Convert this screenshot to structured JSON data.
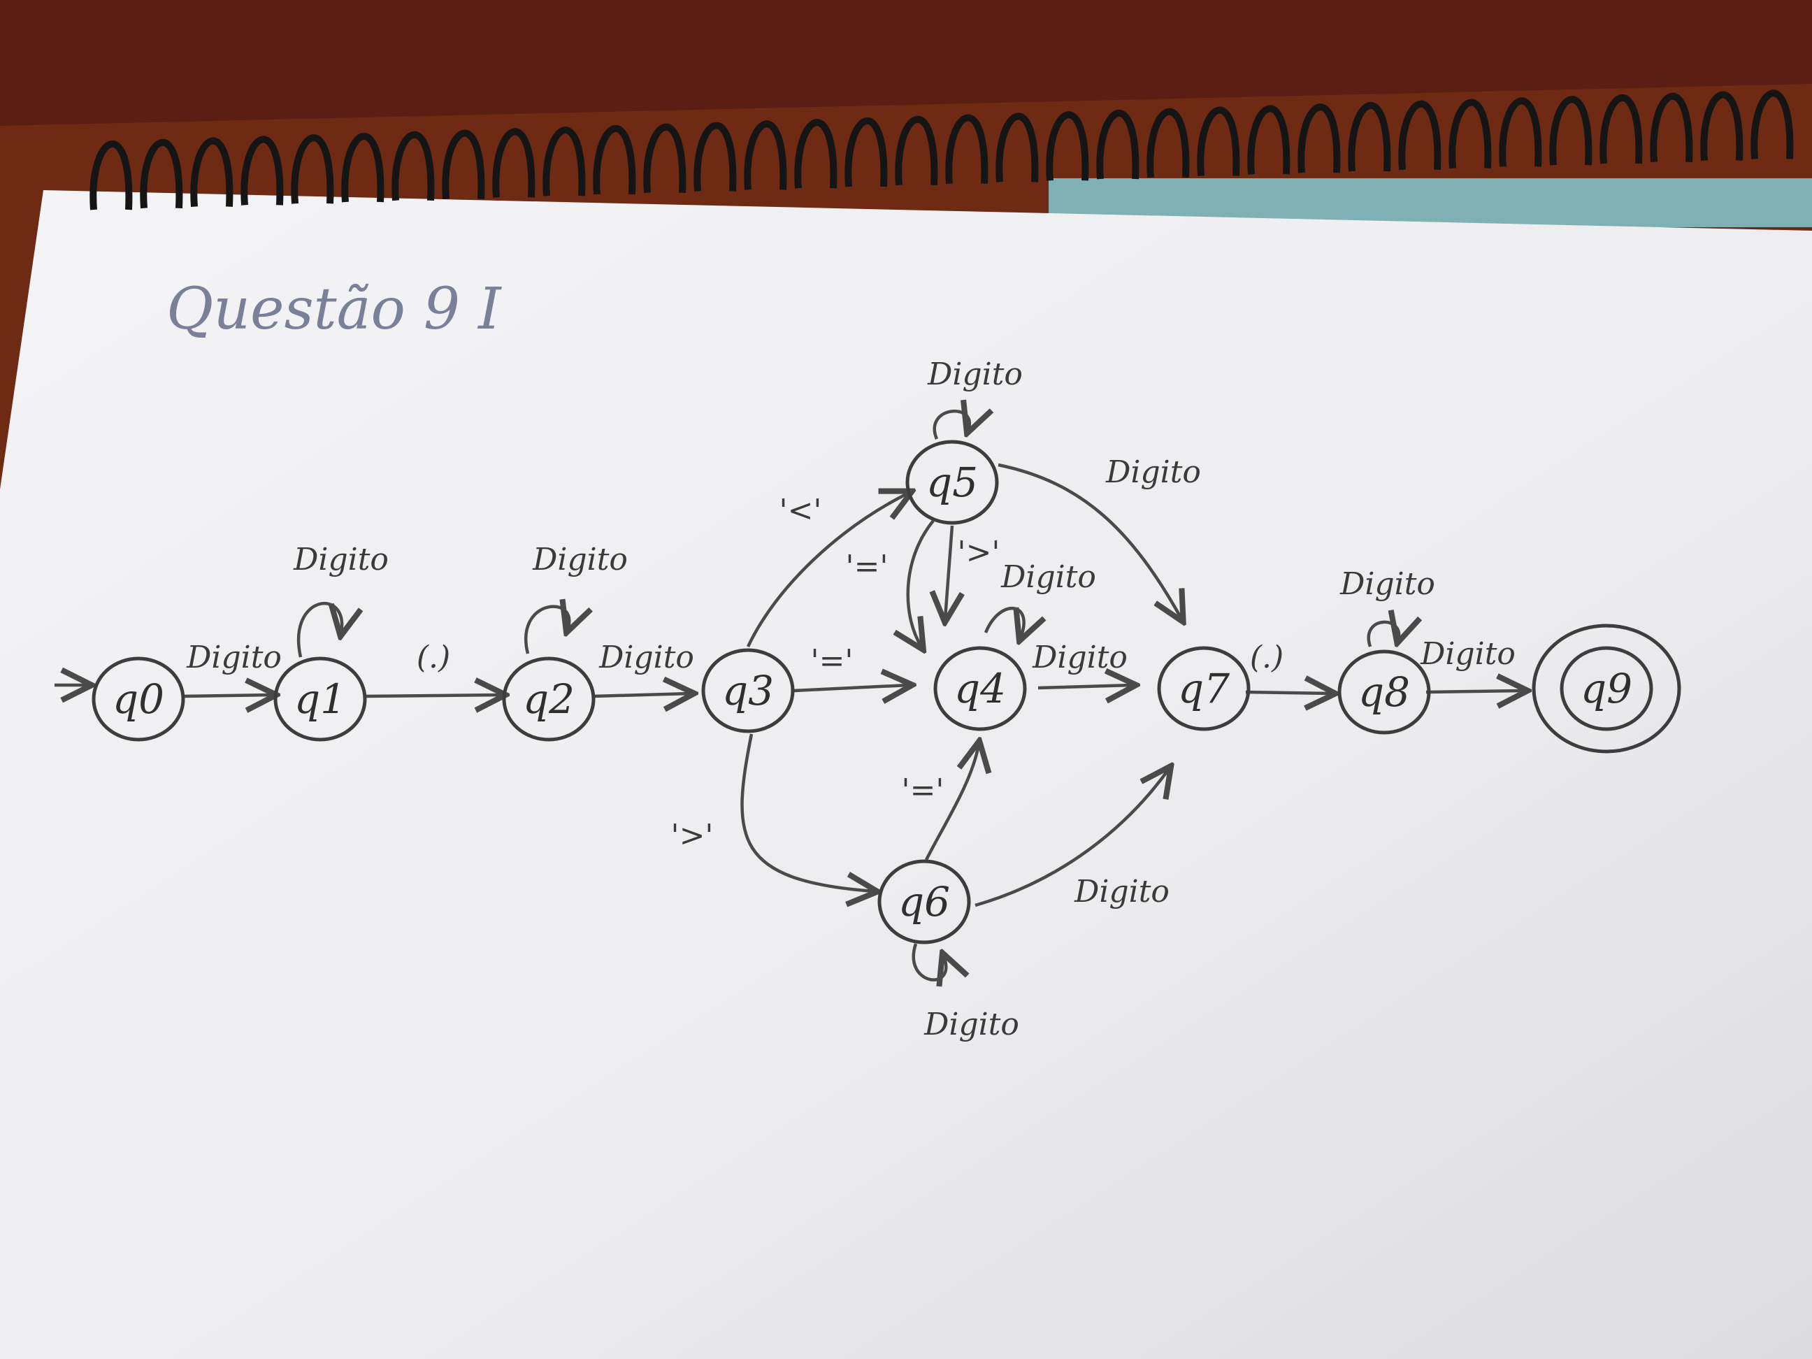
{
  "title": "Questão 9 I",
  "diagram": {
    "states": [
      {
        "id": "q0",
        "label": "q0"
      },
      {
        "id": "q1",
        "label": "q1"
      },
      {
        "id": "q2",
        "label": "q2"
      },
      {
        "id": "q3",
        "label": "q3"
      },
      {
        "id": "q4",
        "label": "q4"
      },
      {
        "id": "q5",
        "label": "q5"
      },
      {
        "id": "q6",
        "label": "q6"
      },
      {
        "id": "q7",
        "label": "q7"
      },
      {
        "id": "q8",
        "label": "q8"
      },
      {
        "id": "q9",
        "label": "q9",
        "accepting": true
      }
    ],
    "start_state": "q0",
    "transitions": [
      {
        "from": "q0",
        "to": "q1",
        "label": "Digito"
      },
      {
        "from": "q1",
        "to": "q1",
        "label": "Digito"
      },
      {
        "from": "q1",
        "to": "q2",
        "label": "(.)"
      },
      {
        "from": "q2",
        "to": "q2",
        "label": "Digito"
      },
      {
        "from": "q2",
        "to": "q3",
        "label": "Digito"
      },
      {
        "from": "q3",
        "to": "q4",
        "label": "'='"
      },
      {
        "from": "q3",
        "to": "q5",
        "label": "'<'"
      },
      {
        "from": "q3",
        "to": "q6",
        "label": "'>'"
      },
      {
        "from": "q5",
        "to": "q5",
        "label": "Digito"
      },
      {
        "from": "q5",
        "to": "q4",
        "label": "'='"
      },
      {
        "from": "q5",
        "to": "q4",
        "label": "'>'"
      },
      {
        "from": "q5",
        "to": "q7",
        "label": "Digito"
      },
      {
        "from": "q4",
        "to": "q4",
        "label": "Digito"
      },
      {
        "from": "q4",
        "to": "q7",
        "label": "Digito"
      },
      {
        "from": "q6",
        "to": "q4",
        "label": "'='"
      },
      {
        "from": "q6",
        "to": "q6",
        "label": "Digito"
      },
      {
        "from": "q6",
        "to": "q7",
        "label": "Digito"
      },
      {
        "from": "q7",
        "to": "q8",
        "label": "(.)"
      },
      {
        "from": "q8",
        "to": "q8",
        "label": "Digito"
      },
      {
        "from": "q8",
        "to": "q9",
        "label": "Digito"
      }
    ]
  }
}
